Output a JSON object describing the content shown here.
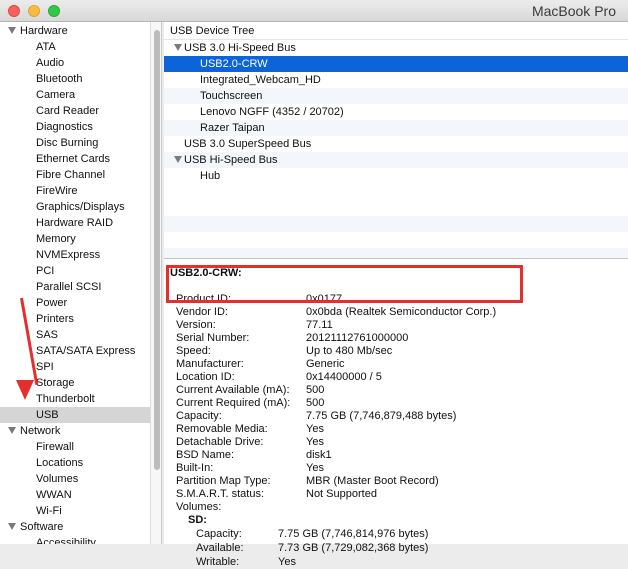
{
  "window": {
    "title": "MacBook Pro"
  },
  "sidebar": {
    "hardware_label": "Hardware",
    "hardware_items": [
      "ATA",
      "Audio",
      "Bluetooth",
      "Camera",
      "Card Reader",
      "Diagnostics",
      "Disc Burning",
      "Ethernet Cards",
      "Fibre Channel",
      "FireWire",
      "Graphics/Displays",
      "Hardware RAID",
      "Memory",
      "NVMExpress",
      "PCI",
      "Parallel SCSI",
      "Power",
      "Printers",
      "SAS",
      "SATA/SATA Express",
      "SPI",
      "Storage",
      "Thunderbolt",
      "USB"
    ],
    "selected_item": "USB",
    "network_label": "Network",
    "network_items": [
      "Firewall",
      "Locations",
      "Volumes",
      "WWAN",
      "Wi-Fi"
    ],
    "software_label": "Software",
    "software_items": [
      "Accessibility"
    ]
  },
  "tree": {
    "header": "USB Device Tree",
    "bus1": "USB 3.0 Hi-Speed Bus",
    "bus1_devices": [
      "USB2.0-CRW",
      "Integrated_Webcam_HD",
      "Touchscreen",
      "Lenovo NGFF (4352 / 20702)",
      "Razer Taipan"
    ],
    "bus2": "USB 3.0 SuperSpeed Bus",
    "bus3": "USB Hi-Speed Bus",
    "bus3_devices": [
      "Hub"
    ]
  },
  "detail": {
    "title": "USB2.0-CRW:",
    "fields": [
      {
        "k": "Product ID:",
        "v": "0x0177"
      },
      {
        "k": "Vendor ID:",
        "v": "0x0bda  (Realtek Semiconductor Corp.)"
      },
      {
        "k": "Version:",
        "v": "77.11"
      },
      {
        "k": "Serial Number:",
        "v": "20121112761000000"
      },
      {
        "k": "Speed:",
        "v": "Up to 480 Mb/sec"
      },
      {
        "k": "Manufacturer:",
        "v": "Generic"
      },
      {
        "k": "Location ID:",
        "v": "0x14400000 / 5"
      },
      {
        "k": "Current Available (mA):",
        "v": "500"
      },
      {
        "k": "Current Required (mA):",
        "v": "500"
      },
      {
        "k": "Capacity:",
        "v": "7.75 GB (7,746,879,488 bytes)"
      },
      {
        "k": "Removable Media:",
        "v": "Yes"
      },
      {
        "k": "Detachable Drive:",
        "v": "Yes"
      },
      {
        "k": "BSD Name:",
        "v": "disk1"
      },
      {
        "k": "Built-In:",
        "v": "Yes"
      },
      {
        "k": "Partition Map Type:",
        "v": "MBR (Master Boot Record)"
      },
      {
        "k": "S.M.A.R.T. status:",
        "v": "Not Supported"
      },
      {
        "k": "Volumes:",
        "v": ""
      }
    ],
    "volume_name": "SD:",
    "volume_fields": [
      {
        "k": "Capacity:",
        "v": "7.75 GB (7,746,814,976 bytes)"
      },
      {
        "k": "Available:",
        "v": "7.73 GB (7,729,082,368 bytes)"
      },
      {
        "k": "Writable:",
        "v": "Yes"
      }
    ]
  },
  "colors": {
    "annotation": "#e62e2b",
    "selection": "#0d63d8"
  }
}
